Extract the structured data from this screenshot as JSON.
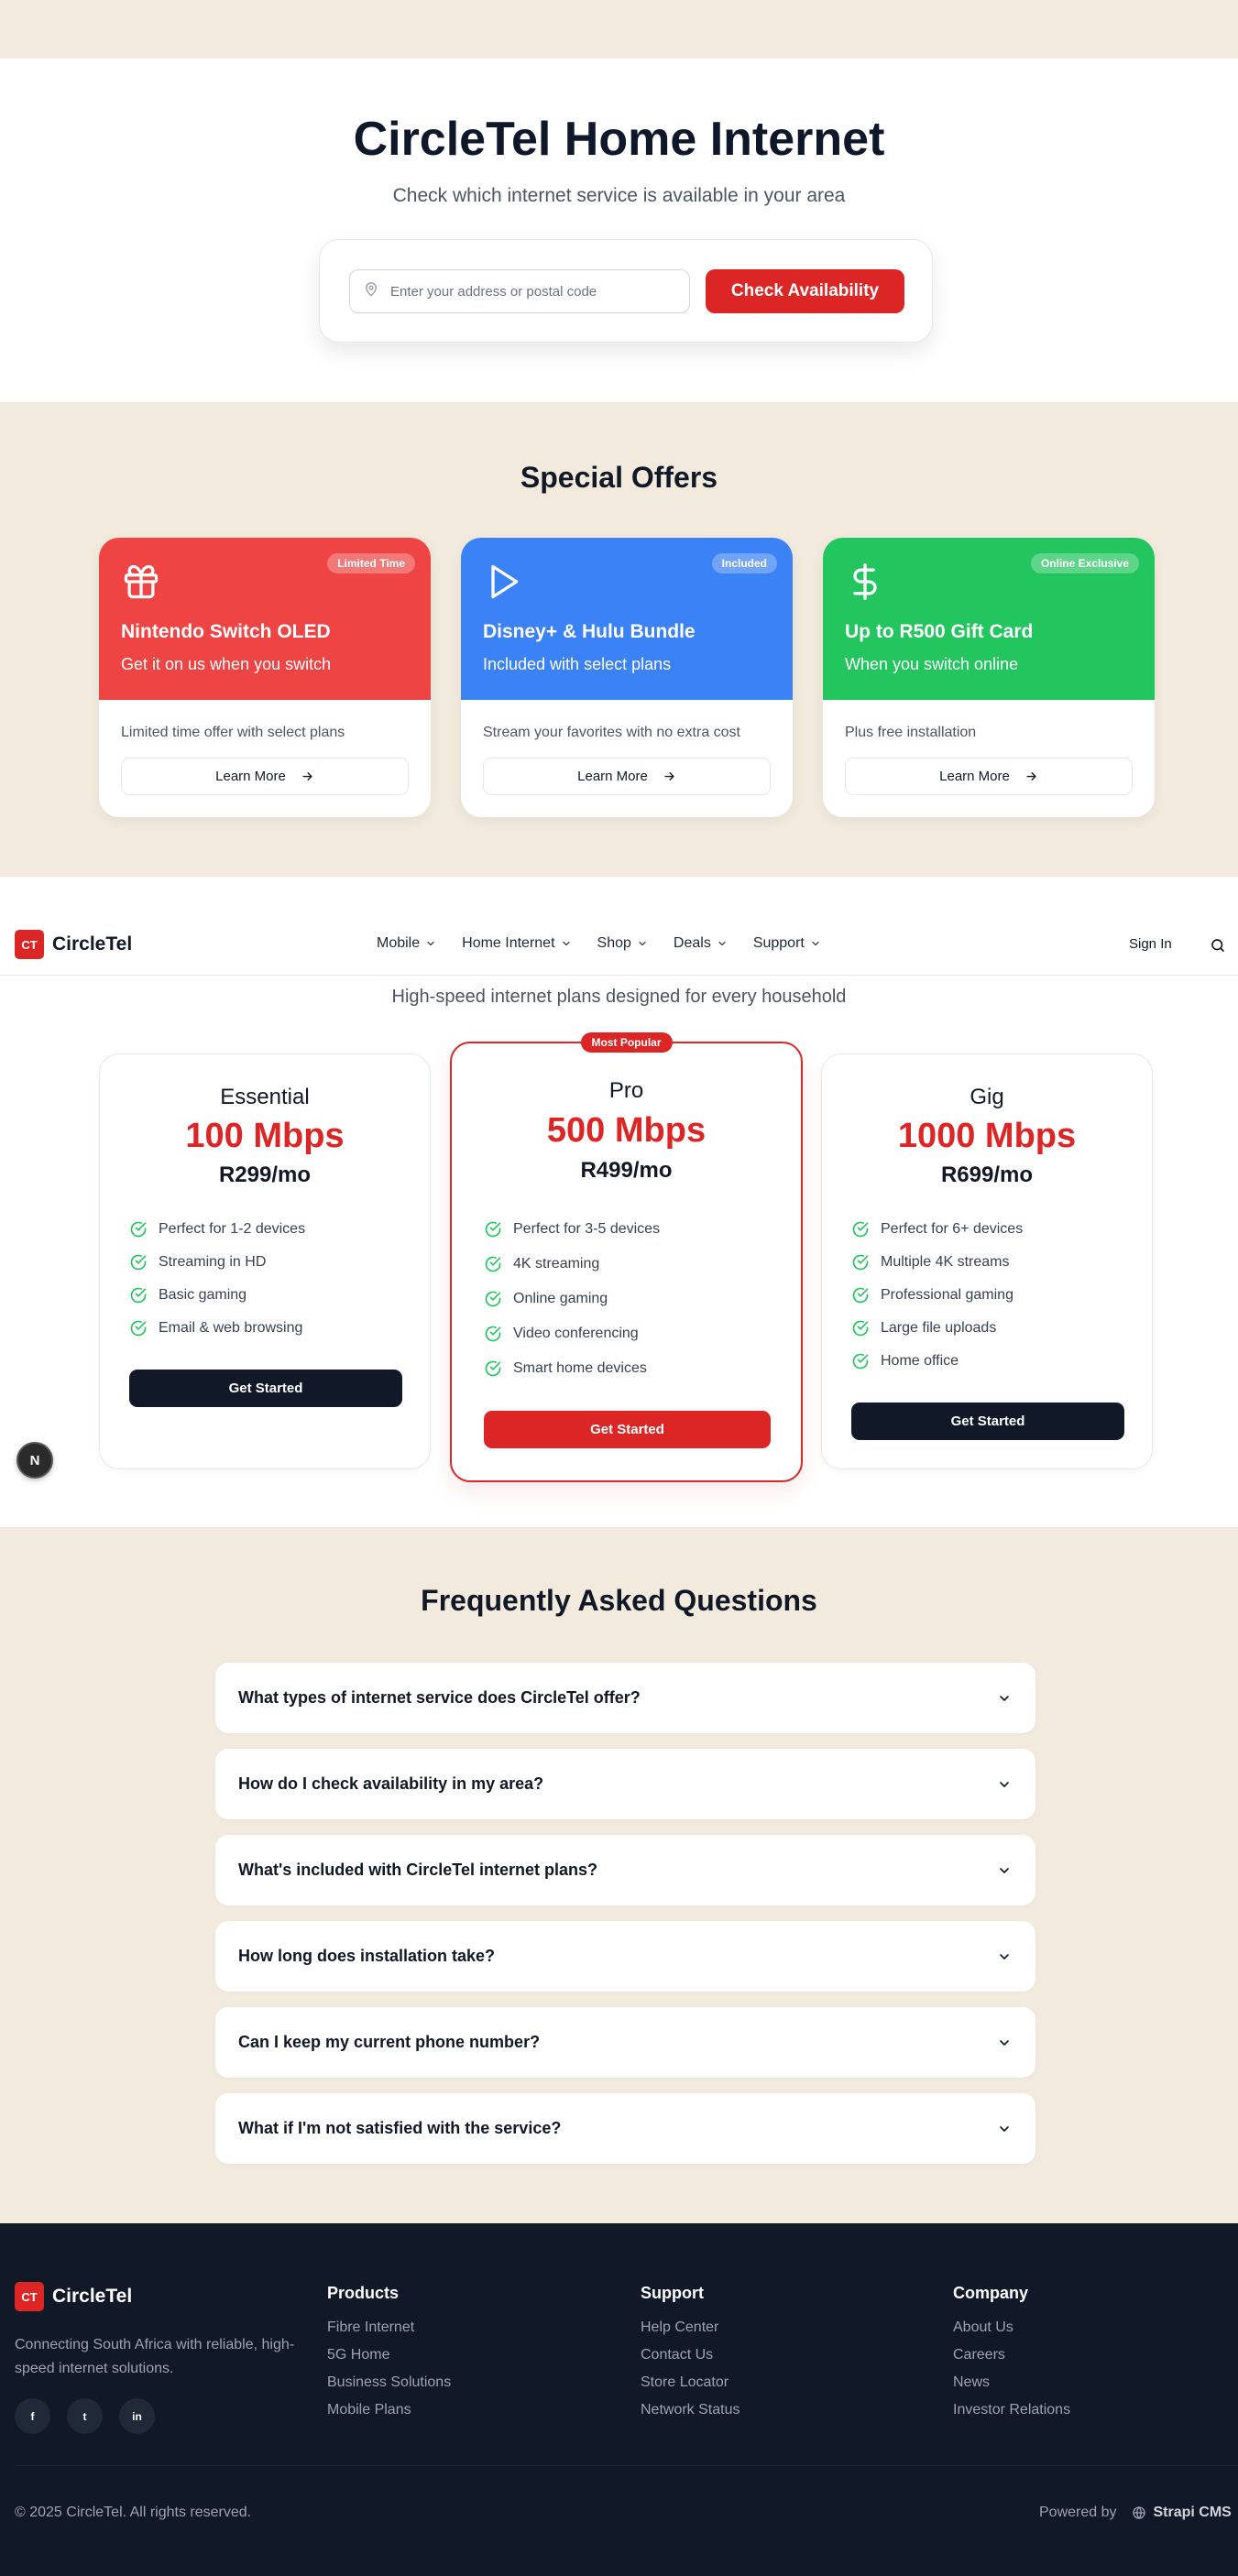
{
  "hero": {
    "title": "CircleTel Home Internet",
    "subtitle": "Check which internet service is available in your area",
    "search_placeholder": "Enter your address or postal code",
    "check_label": "Check Availability"
  },
  "offers": {
    "title": "Special Offers",
    "items": [
      {
        "badge": "Limited Time",
        "icon": "gift-icon",
        "title": "Nintendo Switch OLED",
        "subtitle": "Get it on us when you switch",
        "description": "Limited time offer with select plans",
        "cta": "Learn More",
        "color": "#EF4444"
      },
      {
        "badge": "Included",
        "icon": "play-icon",
        "title": "Disney+ & Hulu Bundle",
        "subtitle": "Included with select plans",
        "description": "Stream your favorites with no extra cost",
        "cta": "Learn More",
        "color": "#3B82F6"
      },
      {
        "badge": "Online Exclusive",
        "icon": "dollar-icon",
        "title": "Up to R500 Gift Card",
        "subtitle": "When you switch online",
        "description": "Plus free installation",
        "cta": "Learn More",
        "color": "#22C55E"
      }
    ]
  },
  "nav": {
    "logo_mark": "CT",
    "brand": "CircleTel",
    "links": [
      "Mobile",
      "Home Internet",
      "Shop",
      "Deals",
      "Support"
    ],
    "sign_in": "Sign In"
  },
  "plans": {
    "subtitle": "High-speed internet plans designed for every household",
    "items": [
      {
        "name": "Essential",
        "speed": "100 Mbps",
        "price": "R299/mo",
        "features": [
          "Perfect for 1-2 devices",
          "Streaming in HD",
          "Basic gaming",
          "Email & web browsing"
        ],
        "cta": "Get Started"
      },
      {
        "name": "Pro",
        "speed": "500 Mbps",
        "price": "R499/mo",
        "badge": "Most Popular",
        "features": [
          "Perfect for 3-5 devices",
          "4K streaming",
          "Online gaming",
          "Video conferencing",
          "Smart home devices"
        ],
        "cta": "Get Started"
      },
      {
        "name": "Gig",
        "speed": "1000 Mbps",
        "price": "R699/mo",
        "features": [
          "Perfect for 6+ devices",
          "Multiple 4K streams",
          "Professional gaming",
          "Large file uploads",
          "Home office"
        ],
        "cta": "Get Started"
      }
    ]
  },
  "floating": {
    "label": "N"
  },
  "faq": {
    "title": "Frequently Asked Questions",
    "items": [
      "What types of internet service does CircleTel offer?",
      "How do I check availability in my area?",
      "What's included with CircleTel internet plans?",
      "How long does installation take?",
      "Can I keep my current phone number?",
      "What if I'm not satisfied with the service?"
    ]
  },
  "footer": {
    "brand": "CircleTel",
    "logo_mark": "CT",
    "description": "Connecting South Africa with reliable, high-speed internet solutions.",
    "socials": [
      "f",
      "t",
      "in"
    ],
    "columns": [
      {
        "title": "Products",
        "links": [
          "Fibre Internet",
          "5G Home",
          "Business Solutions",
          "Mobile Plans"
        ]
      },
      {
        "title": "Support",
        "links": [
          "Help Center",
          "Contact Us",
          "Store Locator",
          "Network Status"
        ]
      },
      {
        "title": "Company",
        "links": [
          "About Us",
          "Careers",
          "News",
          "Investor Relations"
        ]
      }
    ],
    "copyright": "© 2025 CircleTel. All rights reserved.",
    "powered_by": "Powered by",
    "cms": "Strapi CMS"
  },
  "colors": {
    "brand_red": "#DC2626",
    "navy": "#111827",
    "cream": "#F2EBDD",
    "check_green": "#22C55E"
  }
}
